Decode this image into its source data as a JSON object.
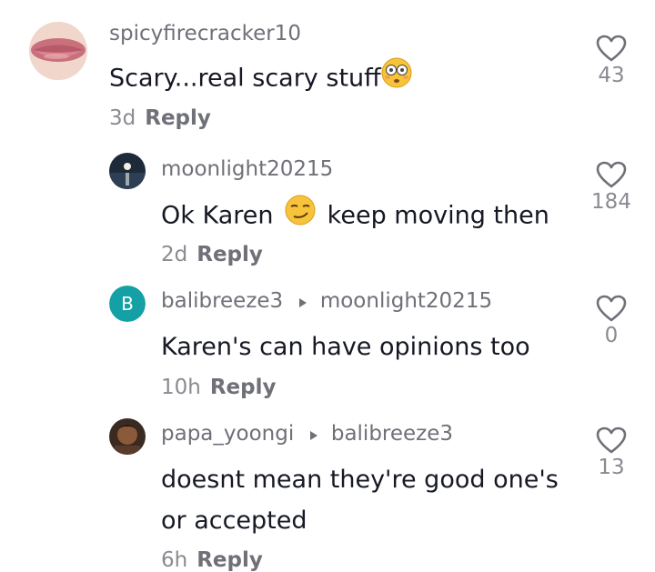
{
  "comments": [
    {
      "username": "spicyfirecracker10",
      "text": "Scary...real scary stuff",
      "emoji": "flushed-face",
      "age": "3d",
      "reply": "Reply",
      "likes": "43"
    },
    {
      "username": "moonlight20215",
      "text_before": "Ok Karen",
      "emoji": "smirking-face",
      "text_after": "keep moving then",
      "age": "2d",
      "reply": "Reply",
      "likes": "184"
    },
    {
      "avatar_letter": "B",
      "avatar_color": "#14a0a5",
      "username": "balibreeze3",
      "reply_to": "moonlight20215",
      "text": "Karen's can have opinions too",
      "age": "10h",
      "reply": "Reply",
      "likes": "0"
    },
    {
      "username": "papa_yoongi",
      "reply_to": "balibreeze3",
      "text_line1": "doesnt mean they're good one's",
      "text_line2": "or accepted",
      "age": "6h",
      "reply": "Reply",
      "likes": "13"
    }
  ]
}
